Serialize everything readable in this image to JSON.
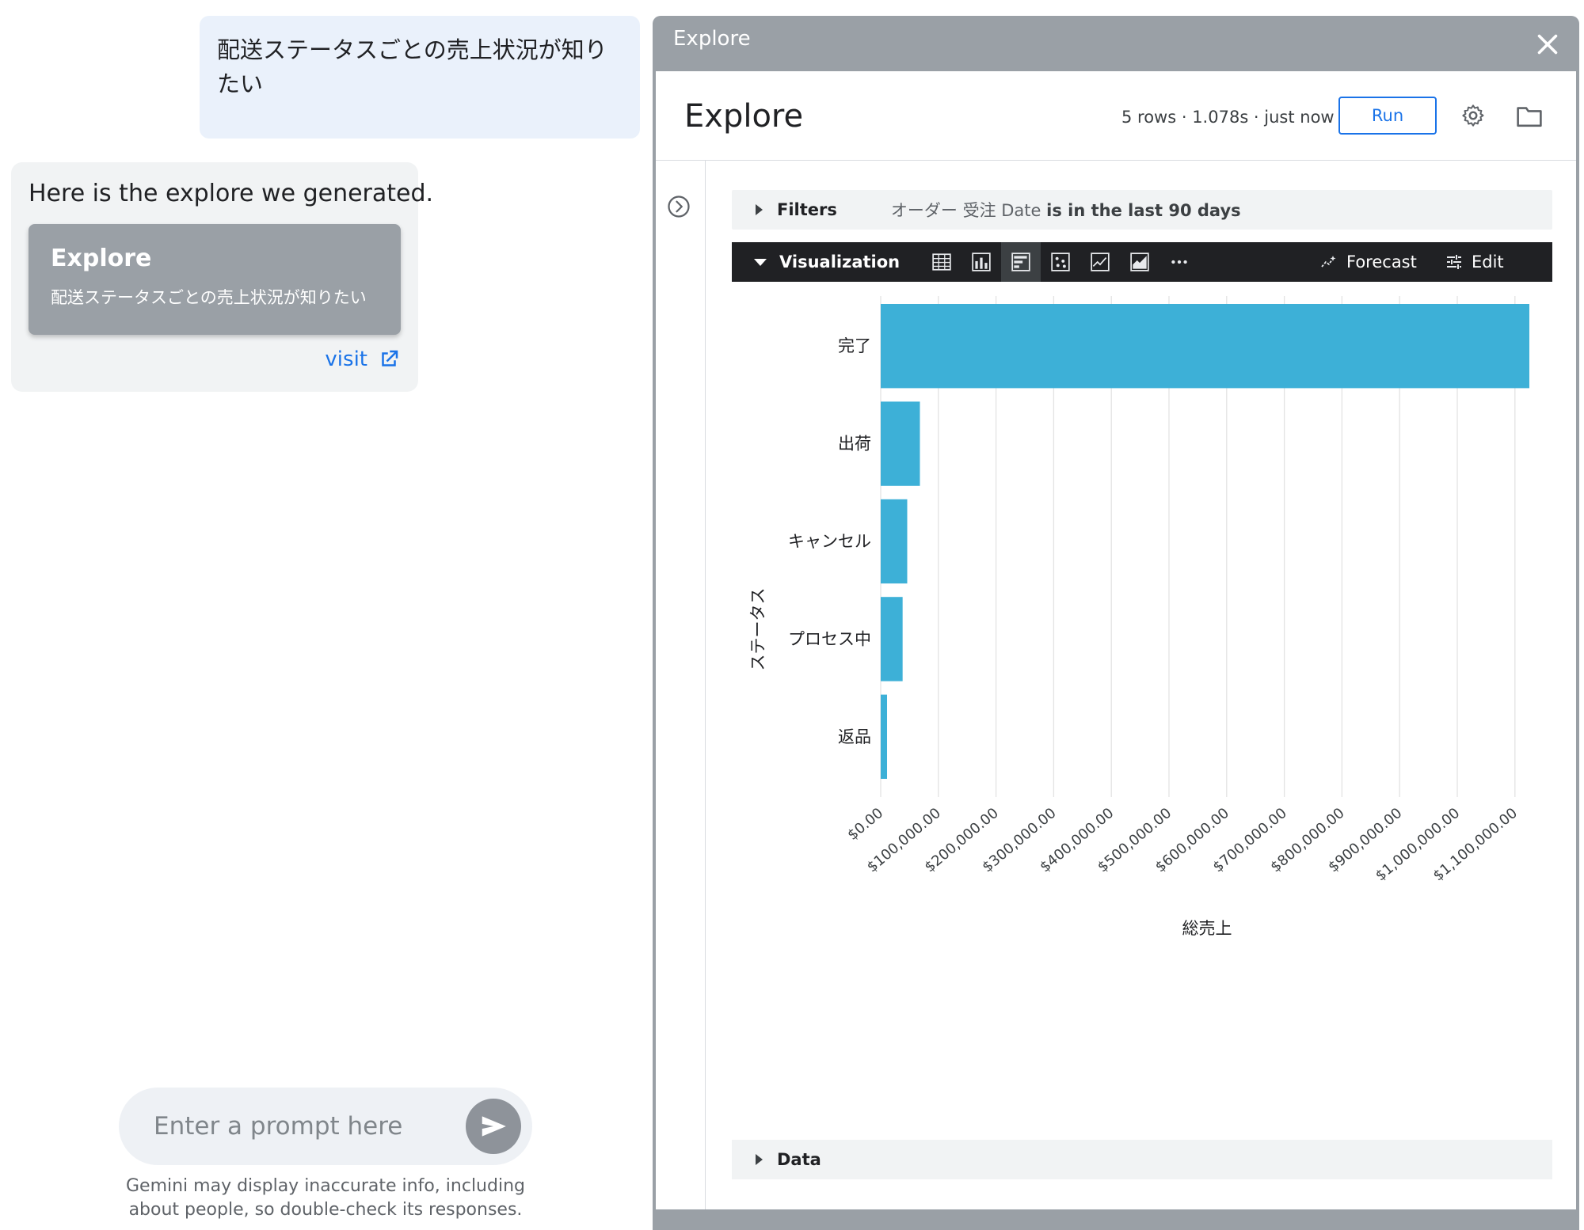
{
  "chat": {
    "user_message": "配送ステータスごとの売上状況が知りたい",
    "bot_message": "Here is the explore we generated.",
    "card_title": "Explore",
    "card_subtitle": "配送ステータスごとの売上状況が知りたい",
    "visit_label": "visit",
    "prompt_placeholder": "Enter a prompt here",
    "disclaimer": "Gemini may display inaccurate info, including about people, so double-check its responses."
  },
  "modal": {
    "title": "Explore",
    "header_title": "Explore",
    "meta": "5 rows · 1.078s · just now",
    "run_label": "Run",
    "filters_label": "Filters",
    "filter_field": "オーダー 受注 Date",
    "filter_condition": "is in the last 90 days",
    "viz_label": "Visualization",
    "forecast_label": "Forecast",
    "edit_label": "Edit",
    "data_label": "Data",
    "bar_color": "#3db0d7"
  },
  "chart_data": {
    "type": "bar",
    "orientation": "horizontal",
    "categories": [
      "完了",
      "出荷",
      "キャンセル",
      "プロセス中",
      "返品"
    ],
    "values": [
      1125000,
      68000,
      46000,
      38000,
      11000
    ],
    "xlabel": "総売上",
    "ylabel": "ステータス",
    "xlim": [
      0,
      1100000
    ],
    "xticks": [
      "$0.00",
      "$100,000.00",
      "$200,000.00",
      "$300,000.00",
      "$400,000.00",
      "$500,000.00",
      "$600,000.00",
      "$700,000.00",
      "$800,000.00",
      "$900,000.00",
      "$1,000,000.00",
      "$1,100,000.00"
    ],
    "grid": true
  }
}
